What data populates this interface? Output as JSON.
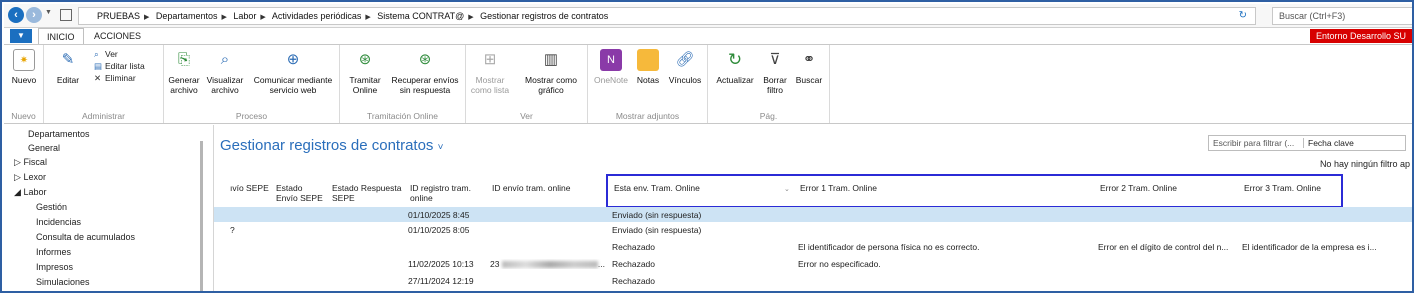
{
  "breadcrumb": [
    "PRUEBAS",
    "Departamentos",
    "Labor",
    "Actividades periódicas",
    "Sistema CONTRAT@",
    "Gestionar registros de contratos"
  ],
  "search": {
    "placeholder": "Buscar (Ctrl+F3)"
  },
  "tabs": {
    "menu": "▼",
    "inicio": "INICIO",
    "acciones": "ACCIONES"
  },
  "environment": "Entorno Desarrollo SU",
  "ribbon": {
    "nuevo": {
      "label": "Nuevo",
      "caption": "Nuevo"
    },
    "administrar": {
      "editar": "Editar",
      "ver": "Ver",
      "editar_lista": "Editar lista",
      "eliminar": "Eliminar",
      "caption": "Administrar"
    },
    "proceso": {
      "generar": "Generar archivo",
      "visualizar": "Visualizar archivo",
      "comunicar": "Comunicar mediante servicio web",
      "caption": "Proceso"
    },
    "tramitacion": {
      "tramitar": "Tramitar Online",
      "recuperar": "Recuperar envíos sin respuesta",
      "caption": "Tramitación Online"
    },
    "ver": {
      "mostrar_lista": "Mostrar como lista",
      "mostrar_grafico": "Mostrar como gráfico",
      "caption": "Ver"
    },
    "adjuntos": {
      "onenote": "OneNote",
      "notas": "Notas",
      "vinculos": "Vínculos",
      "caption": "Mostrar adjuntos"
    },
    "pag": {
      "actualizar": "Actualizar",
      "borrar_filtro": "Borrar filtro",
      "buscar": "Buscar",
      "caption": "Pág."
    }
  },
  "nav": [
    {
      "label": "Departamentos",
      "prefix": ""
    },
    {
      "label": "General",
      "prefix": ""
    },
    {
      "label": "Fiscal",
      "prefix": "▷"
    },
    {
      "label": "Lexor",
      "prefix": "▷"
    },
    {
      "label": "Labor",
      "prefix": "◢"
    },
    {
      "label": "Gestión",
      "prefix": ""
    },
    {
      "label": "Incidencias",
      "prefix": ""
    },
    {
      "label": "Consulta de acumulados",
      "prefix": ""
    },
    {
      "label": "Informes",
      "prefix": ""
    },
    {
      "label": "Impresos",
      "prefix": ""
    },
    {
      "label": "Simulaciones",
      "prefix": ""
    }
  ],
  "page": {
    "title": "Gestionar registros de contratos",
    "title_chevron": "˅",
    "filter_placeholder": "Escribir para filtrar (...",
    "filter_field": "Fecha clave",
    "no_filter": "No hay ningún filtro ap"
  },
  "columns": {
    "envio_sepe": "ıvío SEPE",
    "estado_envio": "Estado Envío SEPE",
    "estado_respuesta": "Estado Respuesta SEPE",
    "id_registro": "ID registro tram. online",
    "id_envio": "ID envío tram. online",
    "esta_env": "Esta env. Tram. Online",
    "error1": "Error 1 Tram. Online",
    "error2": "Error 2 Tram. Online",
    "error3": "Error 3 Tram. Online"
  },
  "rows": [
    {
      "c0": "",
      "id_registro": "01/10/2025 8:45",
      "id_envio": "",
      "esta_env": "Enviado (sin respuesta)",
      "error1": "",
      "error2": "",
      "error3": "",
      "selected": true
    },
    {
      "c0": "?",
      "id_registro": "01/10/2025 8:05",
      "id_envio": "",
      "esta_env": "Enviado (sin respuesta)",
      "error1": "",
      "error2": "",
      "error3": ""
    },
    {
      "c0": "",
      "id_registro": "",
      "id_envio": "",
      "esta_env": "Rechazado",
      "error1": "El identificador de persona física no es correcto.",
      "error2": "Error en el dígito de control del n...",
      "error3": "El identificador de la empresa es i..."
    },
    {
      "c0": "",
      "id_registro": "11/02/2025 10:13",
      "id_envio": "23",
      "id_envio_tail": "...",
      "esta_env": "Rechazado",
      "error1": "Error no especificado.",
      "error2": "",
      "error3": ""
    },
    {
      "c0": "",
      "id_registro": "27/11/2024 12:19",
      "id_envio": "",
      "esta_env": "Rechazado",
      "error1": "",
      "error2": "",
      "error3": ""
    }
  ]
}
